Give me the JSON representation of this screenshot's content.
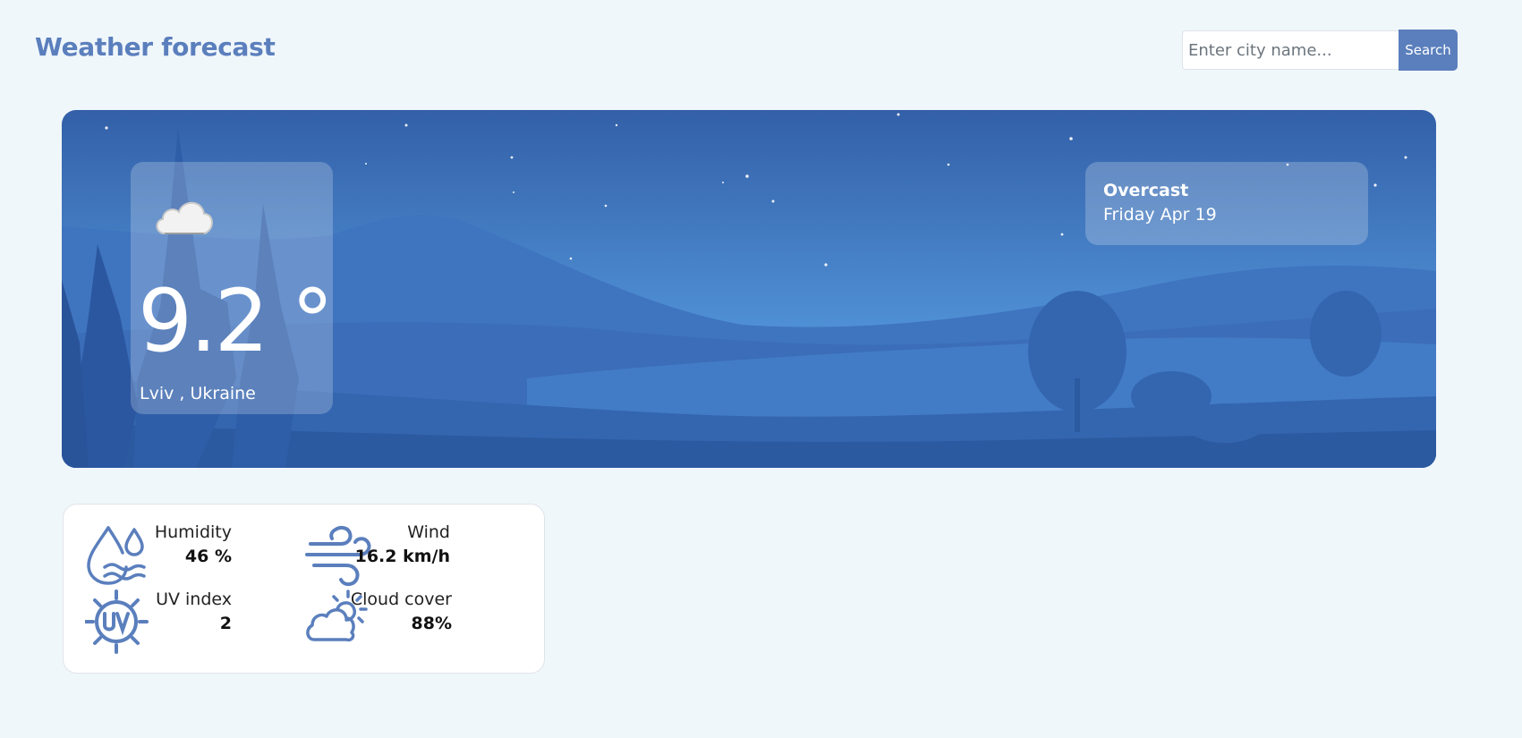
{
  "header": {
    "title": "Weather forecast",
    "search_placeholder": "Enter city name...",
    "search_button": "Search"
  },
  "current": {
    "icon": "cloud-icon",
    "temperature": "9.2 °",
    "location": "Lviv , Ukraine",
    "condition": "Overcast",
    "date": "Friday Apr 19"
  },
  "details": {
    "humidity": {
      "label": "Humidity",
      "value": "46 %",
      "icon": "humidity-icon"
    },
    "wind": {
      "label": "Wind",
      "value": "16.2 km/h",
      "icon": "wind-icon"
    },
    "uv": {
      "label": "UV index",
      "value": "2",
      "icon": "uv-index-icon"
    },
    "cloud_cover": {
      "label": "Cloud cover",
      "value": "88%",
      "icon": "cloud-cover-icon"
    }
  },
  "colors": {
    "accent": "#5b7fbd",
    "page_background": "#f0f7fb"
  }
}
